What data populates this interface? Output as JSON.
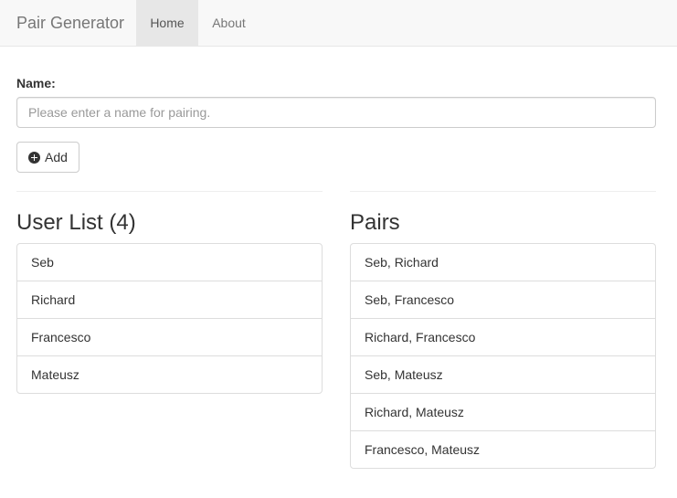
{
  "navbar": {
    "brand": "Pair Generator",
    "items": [
      {
        "label": "Home",
        "active": true
      },
      {
        "label": "About",
        "active": false
      }
    ]
  },
  "form": {
    "label": "Name:",
    "placeholder": "Please enter a name for pairing.",
    "value": "",
    "add_button_label": "Add",
    "add_button_icon": "plus-circle-icon"
  },
  "user_list": {
    "heading": "User List (4)",
    "items": [
      "Seb",
      "Richard",
      "Francesco",
      "Mateusz"
    ]
  },
  "pairs": {
    "heading": "Pairs",
    "items": [
      "Seb, Richard",
      "Seb, Francesco",
      "Richard, Francesco",
      "Seb, Mateusz",
      "Richard, Mateusz",
      "Francesco, Mateusz"
    ]
  }
}
